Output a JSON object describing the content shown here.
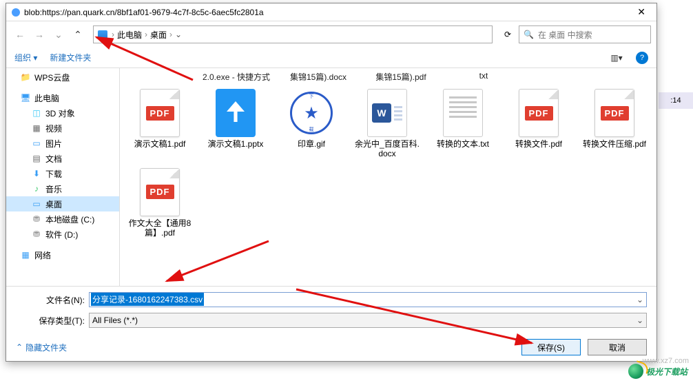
{
  "titlebar": {
    "url": "blob:https://pan.quark.cn/8bf1af01-9679-4c7f-8c5c-6aec5fc2801a",
    "close": "✕"
  },
  "nav": {
    "back": "←",
    "forward": "→",
    "up": "⌃",
    "refresh": "⟳",
    "dropdown": "⌄"
  },
  "breadcrumb": {
    "items": [
      "此电脑",
      "桌面"
    ],
    "sep": "›"
  },
  "search": {
    "placeholder": "在 桌面 中搜索"
  },
  "toolbar": {
    "organize": "组织 ▾",
    "new_folder": "新建文件夹",
    "view": "▥▾"
  },
  "sidebar": {
    "items": [
      {
        "label": "WPS云盘",
        "icon": "📁",
        "color": "#f7b500"
      },
      {
        "label": "此电脑",
        "icon": "🖥",
        "color": "#3a9ef5"
      },
      {
        "label": "3D 对象",
        "icon": "◫",
        "color": "#3ac8f5",
        "sub": true
      },
      {
        "label": "视频",
        "icon": "▦",
        "color": "#6b6b6b",
        "sub": true
      },
      {
        "label": "图片",
        "icon": "▭",
        "color": "#3a9ef5",
        "sub": true
      },
      {
        "label": "文档",
        "icon": "▤",
        "color": "#6b6b6b",
        "sub": true
      },
      {
        "label": "下载",
        "icon": "⬇",
        "color": "#3a9ef5",
        "sub": true
      },
      {
        "label": "音乐",
        "icon": "♪",
        "color": "#3ac86b",
        "sub": true
      },
      {
        "label": "桌面",
        "icon": "▭",
        "color": "#3a9ef5",
        "sub": true,
        "selected": true
      },
      {
        "label": "本地磁盘 (C:)",
        "icon": "⛃",
        "color": "#888",
        "sub": true
      },
      {
        "label": "软件 (D:)",
        "icon": "⛃",
        "color": "#888",
        "sub": true
      },
      {
        "label": "网络",
        "icon": "▦",
        "color": "#3a9ef5"
      }
    ]
  },
  "top_row_labels": [
    "2.0.exe - 快捷方式",
    "集锦15篇).docx",
    "集锦15篇).pdf",
    "txt"
  ],
  "files": [
    {
      "type": "pdf",
      "label": "演示文稿1.pdf"
    },
    {
      "type": "pptx",
      "label": "演示文稿1.pptx"
    },
    {
      "type": "gif",
      "label": "印章.gif"
    },
    {
      "type": "docx",
      "label": "余光中_百度百科.docx"
    },
    {
      "type": "txt",
      "label": "转换的文本.txt"
    },
    {
      "type": "pdf",
      "label": "转换文件.pdf"
    },
    {
      "type": "pdf",
      "label": "转换文件压缩.pdf"
    },
    {
      "type": "pdf",
      "label": "作文大全【通用8篇】.pdf"
    }
  ],
  "filename": {
    "label": "文件名(N):",
    "value": "分享记录-1680162247383.csv"
  },
  "filetype": {
    "label": "保存类型(T):",
    "value": "All Files (*.*)"
  },
  "footer": {
    "hide": "隐藏文件夹",
    "save": "保存(S)",
    "cancel": "取消"
  },
  "ext": {
    "time": ":14"
  },
  "brand": {
    "name": "极光下载站",
    "url": "www.xz7.com"
  },
  "pdf_badge": "PDF",
  "word_w": "W",
  "gif_top": "下",
  "gif_bottom": "载"
}
